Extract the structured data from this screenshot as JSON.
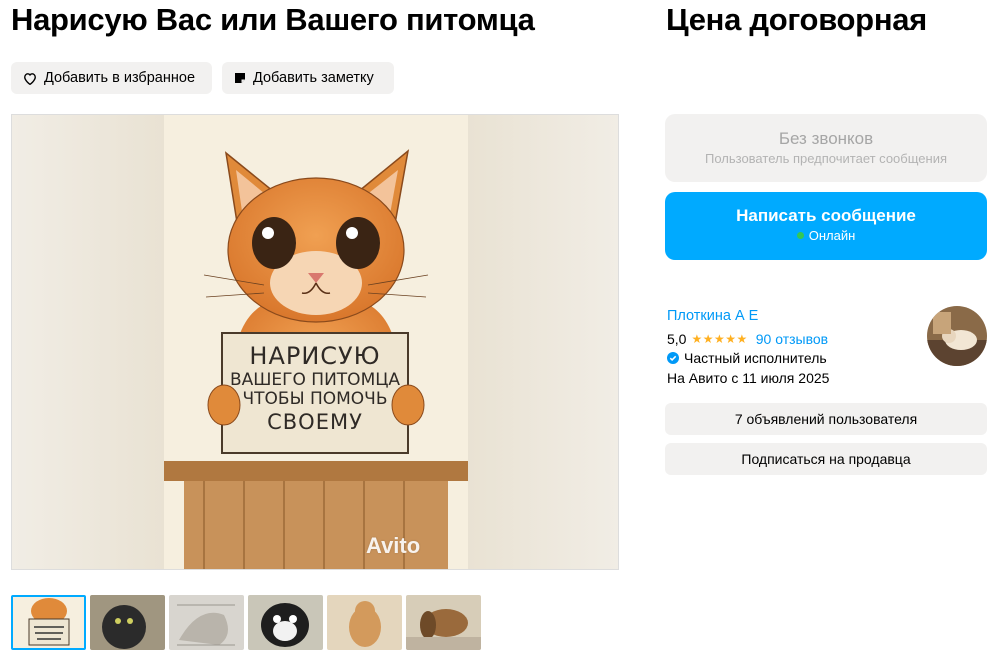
{
  "listing": {
    "title": "Нарисую Вас или Вашего питомца",
    "price": "Цена договорная"
  },
  "actions": {
    "favorite_label": "Добавить в избранное",
    "note_label": "Добавить заметку"
  },
  "gallery": {
    "main_image_alt": "Рисунок рыжего котёнка с табличкой",
    "sign_lines": [
      "НАРИСУЮ",
      "ВАШЕГО ПИТОМЦА",
      "ЧТОБЫ ПОМОЧЬ",
      "СВОЕМУ"
    ],
    "watermark": "Avito",
    "active_thumbnail": 1,
    "thumbnail_count": 6
  },
  "contact": {
    "no_calls_title": "Без звонков",
    "no_calls_subtitle": "Пользователь предпочитает сообщения",
    "message_button_label": "Написать сообщение",
    "online_status": "Онлайн"
  },
  "seller": {
    "name": "Плоткина А Е",
    "rating": "5,0",
    "stars": "★★★★★",
    "reviews": "90 отзывов",
    "type": "Частный исполнитель",
    "since": "На Авито с 11 июля 2025",
    "ads_button": "7 объявлений пользователя",
    "subscribe_button": "Подписаться на продавца"
  },
  "colors": {
    "accent": "#00aaff",
    "link": "#0099f7",
    "star": "#ffb021",
    "online": "#35c853",
    "button_gray": "#f2f1f0"
  },
  "icons": {
    "favorite": "heart-icon",
    "note": "note-icon",
    "verified": "verified-badge-icon"
  }
}
